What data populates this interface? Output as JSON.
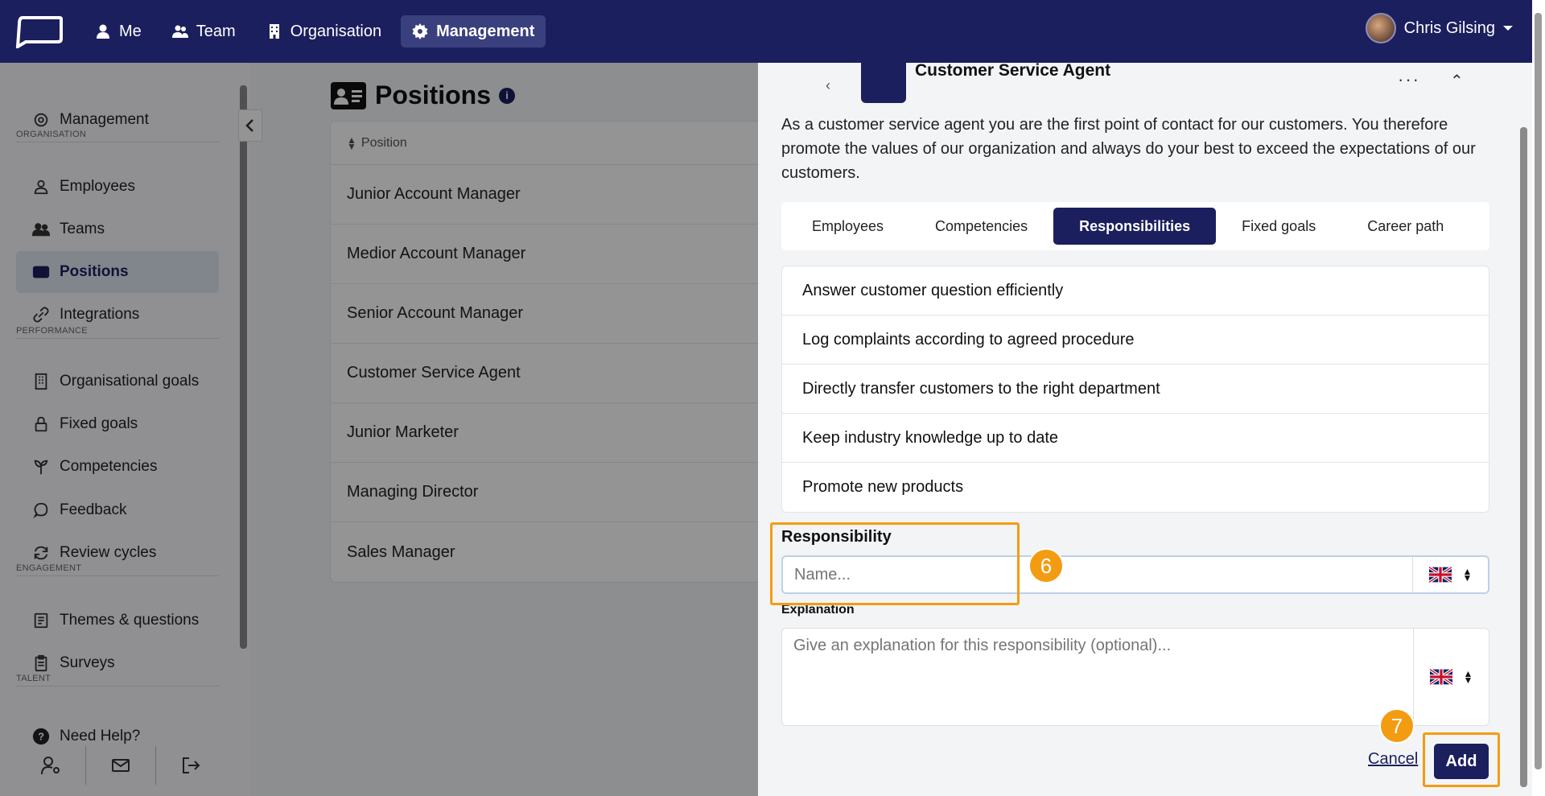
{
  "nav": {
    "items": [
      {
        "label": "Me",
        "icon": "user-icon"
      },
      {
        "label": "Team",
        "icon": "users-icon"
      },
      {
        "label": "Organisation",
        "icon": "building-icon"
      },
      {
        "label": "Management",
        "icon": "gear-icon",
        "active": true
      }
    ],
    "user_name": "Chris Gilsing"
  },
  "sidebar": {
    "items": [
      {
        "label": "Management",
        "icon": "gear-icon"
      },
      {
        "label": "Employees",
        "icon": "user-icon"
      },
      {
        "label": "Teams",
        "icon": "users-icon"
      },
      {
        "label": "Positions",
        "icon": "id-card-icon",
        "active": true
      },
      {
        "label": "Integrations",
        "icon": "link-icon"
      },
      {
        "label": "Organisational goals",
        "icon": "building-icon"
      },
      {
        "label": "Fixed goals",
        "icon": "lock-icon"
      },
      {
        "label": "Competencies",
        "icon": "sprout-icon"
      },
      {
        "label": "Feedback",
        "icon": "chat-icon"
      },
      {
        "label": "Review cycles",
        "icon": "refresh-icon"
      },
      {
        "label": "Themes & questions",
        "icon": "book-icon"
      },
      {
        "label": "Surveys",
        "icon": "clipboard-icon"
      },
      {
        "label": "Need Help?",
        "icon": "help-icon"
      }
    ],
    "sections": {
      "organisation": "ORGANISATION",
      "performance": "PERFORMANCE",
      "engagement": "ENGAGEMENT",
      "talent": "TALENT"
    }
  },
  "main": {
    "title": "Positions",
    "column_header": "Position",
    "rows": [
      "Junior Account Manager",
      "Medior Account Manager",
      "Senior Account Manager",
      "Customer Service Agent",
      "Junior Marketer",
      "Managing Director",
      "Sales Manager"
    ]
  },
  "panel": {
    "title": "Customer Service Agent",
    "description": "As a customer service agent you are the first point of contact for our customers. You therefore promote the values of our organization and always do your best to exceed the expectations of our customers.",
    "tabs": [
      "Employees",
      "Competencies",
      "Responsibilities",
      "Fixed goals",
      "Career path"
    ],
    "active_tab": "Responsibilities",
    "responsibilities": [
      "Answer customer question efficiently",
      "Log complaints according to agreed procedure",
      "Directly transfer customers to the right department",
      "Keep industry knowledge up to date",
      "Promote new products"
    ],
    "form": {
      "responsibility_label": "Responsibility",
      "name_placeholder": "Name...",
      "explanation_label": "Explanation",
      "explanation_placeholder": "Give an explanation for this responsibility (optional)...",
      "cancel_label": "Cancel",
      "add_label": "Add"
    }
  },
  "annotations": {
    "step6": "6",
    "step7": "7"
  },
  "colors": {
    "brand": "#1b1f5e",
    "highlight": "#f39c12"
  }
}
